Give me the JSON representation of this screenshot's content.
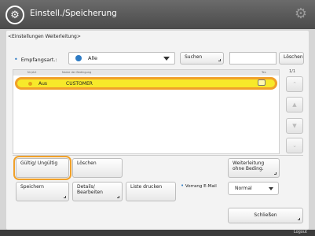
{
  "header": {
    "title": "Einstell./Speicherung",
    "icon": "settings-wrench-icon",
    "gear_icon": "gear-icon"
  },
  "breadcrumb": "<Einstellungen Weiterleitung>",
  "filter": {
    "label": "Empfangsart.:",
    "selected": "Alle"
  },
  "search": {
    "label": "Suchen",
    "value": "",
    "delete_label": "Löschen"
  },
  "list": {
    "columns": [
      "Nr./Art",
      "Name der Bedingung",
      "Tes"
    ],
    "rows": [
      {
        "type": "Aus",
        "name": "CUSTOMER"
      }
    ],
    "page_indicator": "1/1"
  },
  "actions": {
    "valid_invalid": "Gültig/ Ungültig",
    "delete": "Löschen",
    "forward_without_condition": "Weiterleitung ohne Beding.",
    "save": "Speichern",
    "edit_details": "Details/ Bearbeiten",
    "print_list": "Liste drucken",
    "priority_label": "Vorrang E-Mail",
    "priority_value": "Normal",
    "close": "Schließen"
  },
  "footer": {
    "logout": "Logout"
  },
  "colors": {
    "selected_row": "#f7e92a",
    "highlight_border": "#f0a12a",
    "accent": "#2d7bc4"
  }
}
